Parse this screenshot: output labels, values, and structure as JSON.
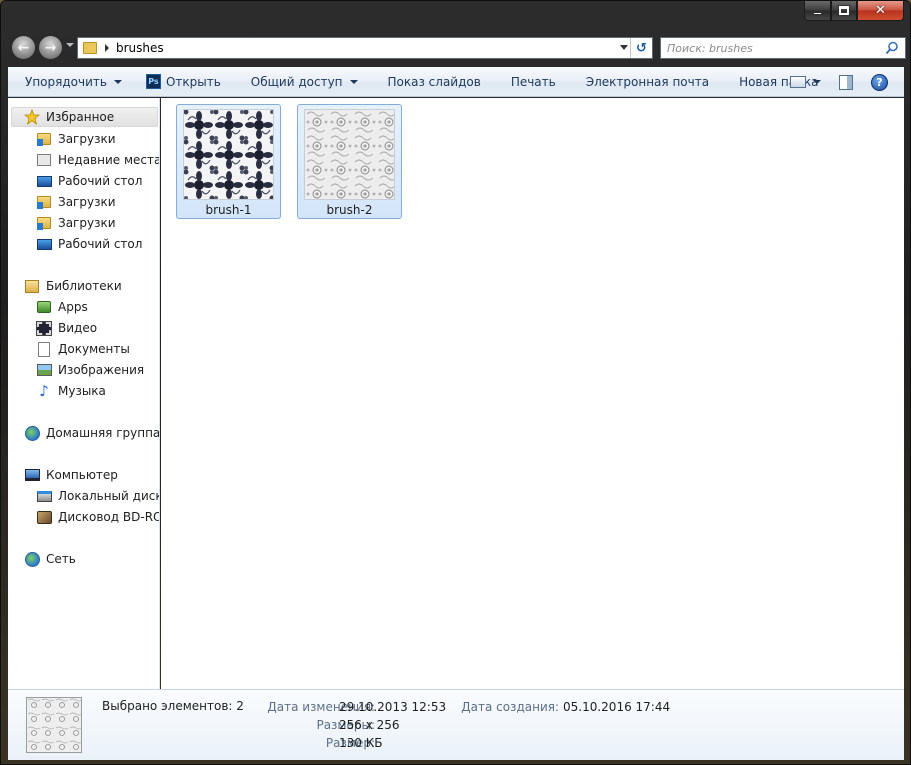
{
  "window": {
    "minimize_glyph": "",
    "close_glyph": "✕"
  },
  "address": {
    "path_segment": "brushes",
    "search_placeholder": "Поиск: brushes"
  },
  "toolbar": {
    "organize": "Упорядочить",
    "open": "Открыть",
    "ps_badge": "Ps",
    "share": "Общий доступ",
    "slideshow": "Показ слайдов",
    "print": "Печать",
    "email": "Электронная почта",
    "new_folder": "Новая папка",
    "help": "?"
  },
  "sidebar": {
    "favorites": {
      "label": "Избранное",
      "items": [
        {
          "label": "Загрузки",
          "icon": "downloads-folder-icon"
        },
        {
          "label": "Недавние места",
          "icon": "recent-places-icon"
        },
        {
          "label": "Рабочий стол",
          "icon": "desktop-icon"
        },
        {
          "label": "Загрузки",
          "icon": "downloads-folder-icon"
        },
        {
          "label": "Загрузки",
          "icon": "downloads-folder-icon"
        },
        {
          "label": "Рабочий стол",
          "icon": "desktop-icon"
        }
      ]
    },
    "libraries": {
      "label": "Библиотеки",
      "items": [
        {
          "label": "Apps",
          "icon": "apps-library-icon"
        },
        {
          "label": "Видео",
          "icon": "video-library-icon"
        },
        {
          "label": "Документы",
          "icon": "documents-library-icon"
        },
        {
          "label": "Изображения",
          "icon": "pictures-library-icon"
        },
        {
          "label": "Музыка",
          "icon": "music-library-icon"
        }
      ]
    },
    "homegroup": {
      "label": "Домашняя группа"
    },
    "computer": {
      "label": "Компьютер",
      "items": [
        {
          "label": "Локальный диск (C:)",
          "icon": "local-disk-icon"
        },
        {
          "label": "Дисковод BD-ROM",
          "icon": "bd-rom-drive-icon"
        }
      ]
    },
    "network": {
      "label": "Сеть"
    }
  },
  "files": [
    {
      "name": "brush-1",
      "selected": true
    },
    {
      "name": "brush-2",
      "selected": true
    }
  ],
  "details": {
    "selected_count": "Выбрано элементов: 2",
    "modified_label": "Дата изменения:",
    "modified_value": "29.10.2013 12:53",
    "created_label": "Дата создания:",
    "created_value": "05.10.2016 17:44",
    "dimensions_label": "Размеры:",
    "dimensions_value": "256 x 256",
    "size_label": "Размер:",
    "size_value": "130 КБ"
  },
  "colors": {
    "selection_fill": "#d3e5fa",
    "selection_border": "#84acdd",
    "toolbar_text": "#1e395b"
  }
}
